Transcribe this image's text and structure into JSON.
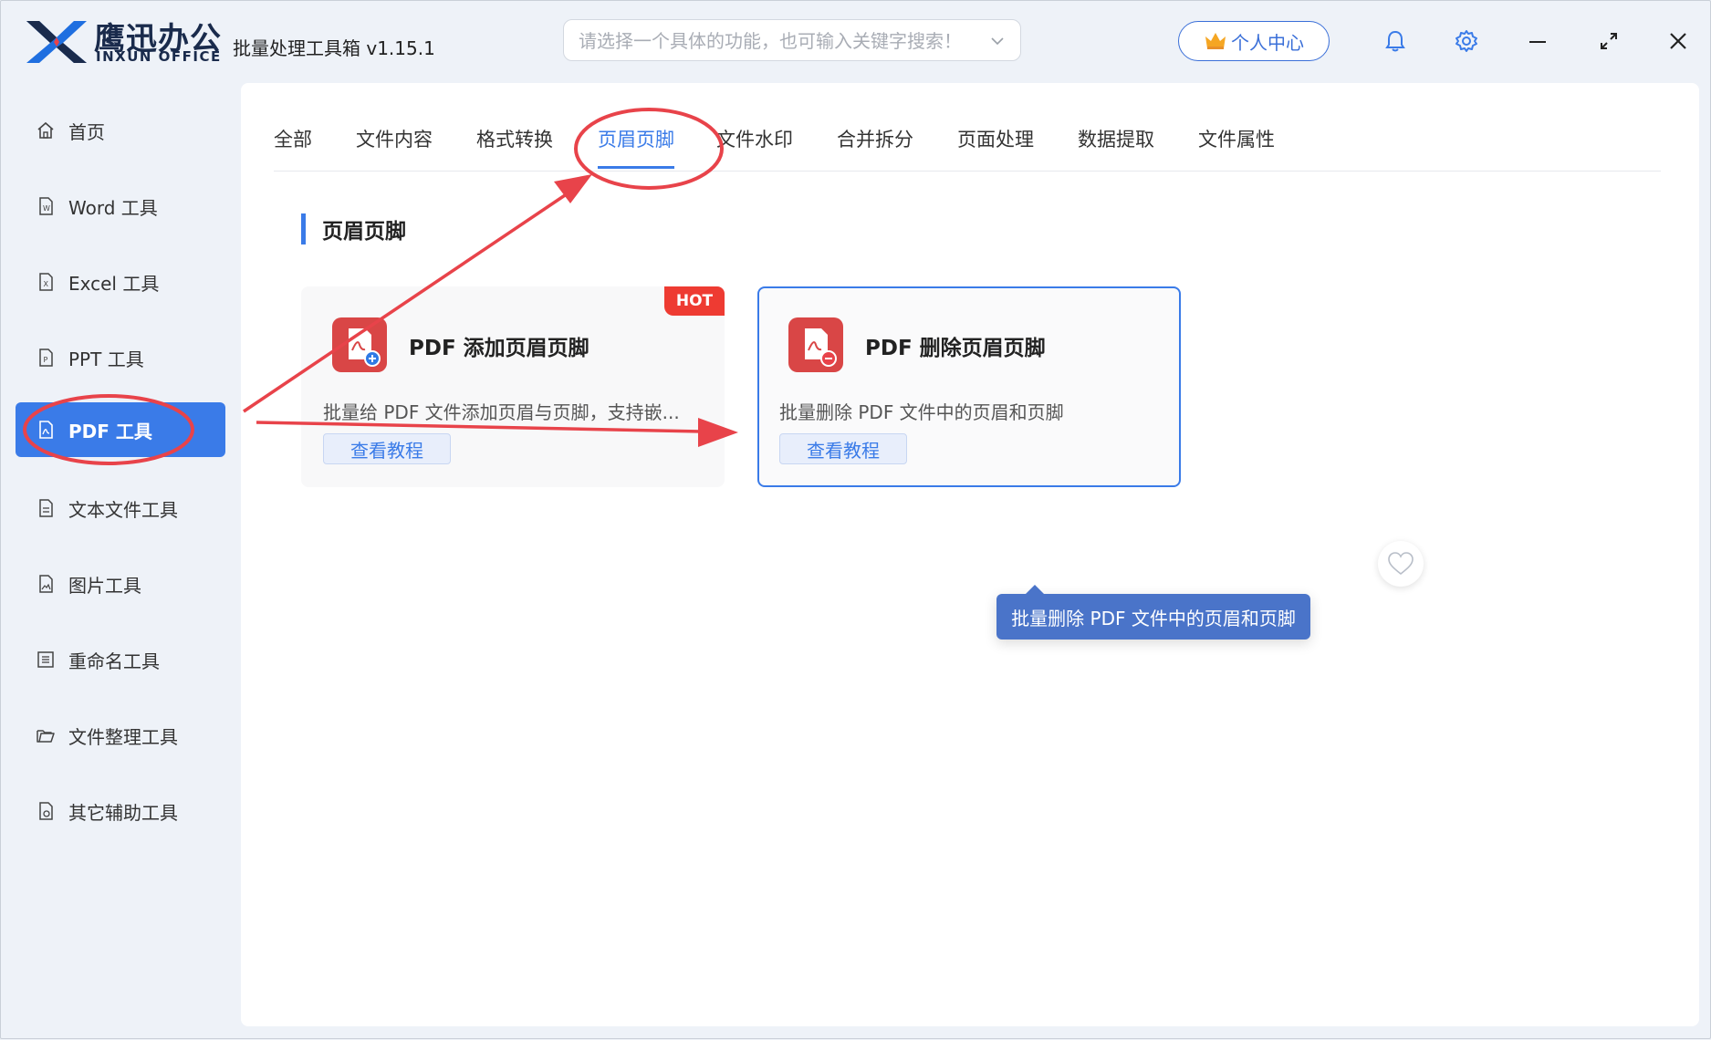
{
  "app": {
    "brand_cn": "鹰迅办公",
    "brand_en": "INXUN OFFICE",
    "title": "批量处理工具箱 v1.15.1"
  },
  "search": {
    "placeholder": "请选择一个具体的功能，也可输入关键字搜索！"
  },
  "header": {
    "user_center_label": "个人中心"
  },
  "sidebar": {
    "items": [
      {
        "label": "首页",
        "icon": "home-icon"
      },
      {
        "label": "Word 工具",
        "icon": "word-file-icon"
      },
      {
        "label": "Excel 工具",
        "icon": "excel-file-icon"
      },
      {
        "label": "PPT 工具",
        "icon": "ppt-file-icon"
      },
      {
        "label": "PDF 工具",
        "icon": "pdf-file-icon",
        "active": true
      },
      {
        "label": "文本文件工具",
        "icon": "text-file-icon"
      },
      {
        "label": "图片工具",
        "icon": "image-file-icon"
      },
      {
        "label": "重命名工具",
        "icon": "rename-icon"
      },
      {
        "label": "文件整理工具",
        "icon": "folder-icon"
      },
      {
        "label": "其它辅助工具",
        "icon": "misc-tools-icon"
      }
    ]
  },
  "tabs": [
    {
      "label": "全部"
    },
    {
      "label": "文件内容"
    },
    {
      "label": "格式转换"
    },
    {
      "label": "页眉页脚",
      "active": true
    },
    {
      "label": "文件水印"
    },
    {
      "label": "合并拆分"
    },
    {
      "label": "页面处理"
    },
    {
      "label": "数据提取"
    },
    {
      "label": "文件属性"
    }
  ],
  "section": {
    "title": "页眉页脚"
  },
  "cards": [
    {
      "title": "PDF 添加页眉页脚",
      "description": "批量给 PDF 文件添加页眉与页脚，支持嵌...",
      "tutorial_label": "查看教程",
      "badge": "HOT",
      "icon": "pdf-add-icon"
    },
    {
      "title": "PDF 删除页眉页脚",
      "description": "批量删除 PDF 文件中的页眉和页脚",
      "tutorial_label": "查看教程",
      "icon": "pdf-remove-icon"
    }
  ],
  "tooltip": {
    "text": "批量删除 PDF 文件中的页眉和页脚"
  },
  "colors": {
    "accent": "#3a7be8",
    "annotation": "#e8434a",
    "hot_badge": "#ee3b32",
    "brand_dark": "#1a2b4c",
    "pdf_red": "#d94646"
  }
}
